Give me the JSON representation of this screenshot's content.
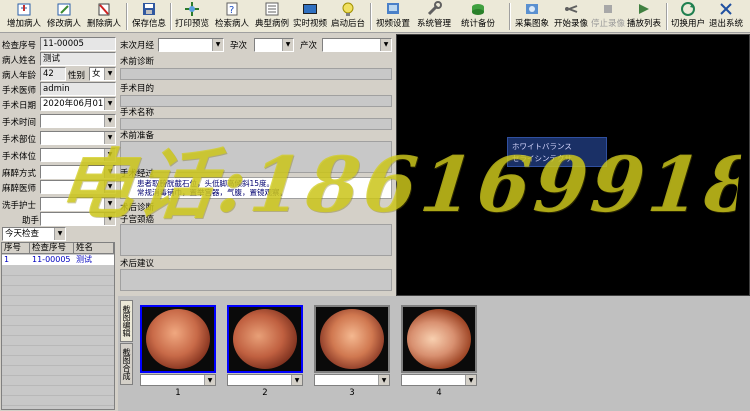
{
  "toolbar": {
    "buttons": [
      {
        "label": "增加病人",
        "icon": "add-patient-icon"
      },
      {
        "label": "修改病人",
        "icon": "edit-patient-icon"
      },
      {
        "label": "删除病人",
        "icon": "delete-patient-icon"
      },
      {
        "label": "保存信息",
        "icon": "save-icon"
      },
      {
        "label": "打印预览",
        "icon": "print-preview-icon"
      },
      {
        "label": "检索病人",
        "icon": "search-patient-icon"
      },
      {
        "label": "典型病例",
        "icon": "typical-case-icon"
      },
      {
        "label": "实时视频",
        "icon": "live-video-icon"
      },
      {
        "label": "启动后台",
        "icon": "background-service-icon"
      },
      {
        "label": "视频设置",
        "icon": "video-settings-icon"
      },
      {
        "label": "系统管理",
        "icon": "system-management-icon"
      },
      {
        "label": "统计备份",
        "icon": "statistics-backup-icon"
      },
      {
        "label": "采集图象",
        "icon": "capture-image-icon"
      },
      {
        "label": "开始录像",
        "icon": "start-recording-icon"
      },
      {
        "label": "停止录像",
        "icon": "stop-recording-icon",
        "disabled": true
      },
      {
        "label": "播放列表",
        "icon": "playlist-icon"
      },
      {
        "label": "切换用户",
        "icon": "switch-user-icon"
      },
      {
        "label": "退出系统",
        "icon": "exit-icon"
      }
    ]
  },
  "patient": {
    "check_no_label": "检查序号",
    "check_no": "11-00005",
    "name_label": "病人姓名",
    "name": "测试",
    "age_label": "病人年龄",
    "age": "42",
    "sex_label": "性别",
    "sex": "女",
    "doctor_label": "手术医师",
    "doctor": "admin",
    "date_label": "手术日期",
    "date": "2020年06月01日",
    "time_label": "手术时间",
    "site_label": "手术部位",
    "position_label": "手术体位",
    "anesthesia_label": "麻醉方式",
    "anesthetist_label": "麻醉医师",
    "nurse_label": "洗手护士",
    "assistant_label": "助手",
    "filter": "今天检查"
  },
  "patient_table": {
    "columns": [
      "序号",
      "检查序号",
      "姓名"
    ],
    "rows": [
      [
        "1",
        "11-00005",
        "测试"
      ]
    ]
  },
  "form": {
    "last_period_label": "末次月经",
    "pregnancy_label": "孕次",
    "birth_label": "产次",
    "preop_diag_label": "术前诊断",
    "purpose_label": "手术目的",
    "name_label": "手术名称",
    "prep_label": "术前准备",
    "process_label": "手术经过",
    "process_text": "患者取膀胱截石位，头低脚高倾斜15度。\n常规消毒铺巾，置举宫器，气腹，置镜观察。",
    "postop_diag_label": "术后诊断",
    "uterus_label": "子宫颈癌",
    "advice_label": "术后建议"
  },
  "video": {
    "menu_line1": "ホワイトバランス",
    "menu_line2": "セライシンテクサ"
  },
  "thumbnails": {
    "tabs": [
      "截图编辑",
      "截图合成"
    ],
    "items": [
      {
        "num": "1",
        "selected": true
      },
      {
        "num": "2",
        "selected": true
      },
      {
        "num": "3",
        "selected": false
      },
      {
        "num": "4",
        "selected": false
      }
    ]
  },
  "watermark": "电话:18616991819"
}
